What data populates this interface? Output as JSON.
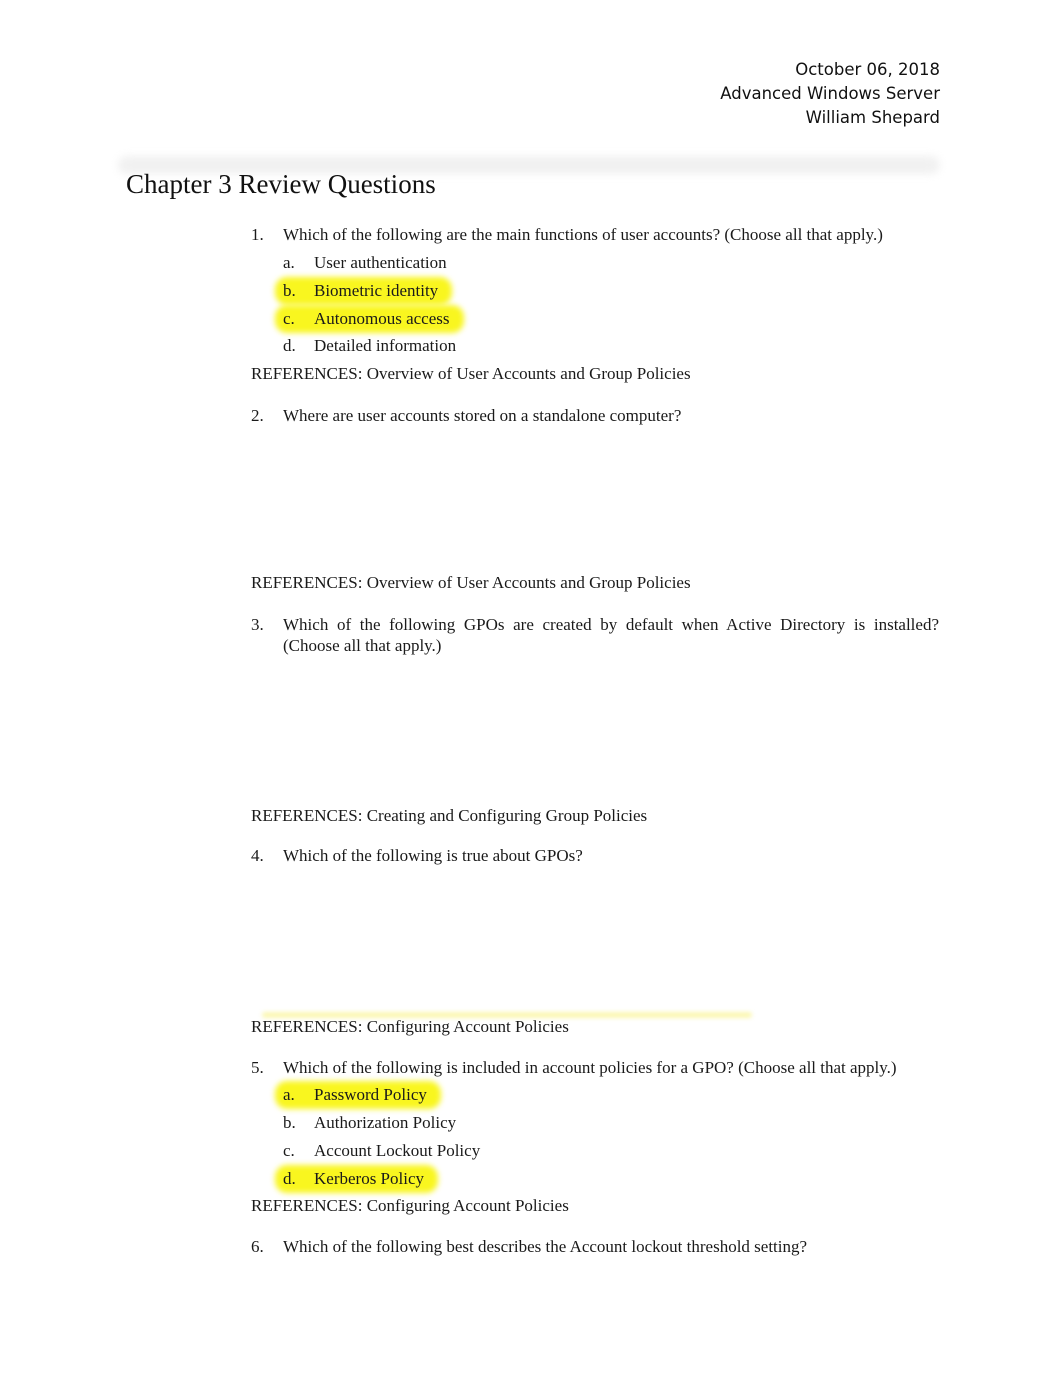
{
  "header": {
    "date": "October 06, 2018",
    "course": "Advanced Windows Server",
    "author": "William Shepard"
  },
  "title": "Chapter 3 Review Questions",
  "highlight_color": "#f9f61f",
  "questions": [
    {
      "number": "1.",
      "text": "Which of the following are the main functions of user accounts? (Choose all that apply.)",
      "options": [
        {
          "letter": "a.",
          "text": "User authentication",
          "highlighted": false
        },
        {
          "letter": "b.",
          "text": "Biometric identity",
          "highlighted": true
        },
        {
          "letter": "c.",
          "text": "Autonomous access",
          "highlighted": true
        },
        {
          "letter": "d.",
          "text": "Detailed information",
          "highlighted": false
        }
      ],
      "reference": "REFERENCES: Overview of User Accounts and Group Policies"
    },
    {
      "number": "2.",
      "text": "Where are user accounts stored on a standalone computer?",
      "options": [],
      "reference": "REFERENCES: Overview of User Accounts and Group Policies"
    },
    {
      "number": "3.",
      "text": "Which of the following GPOs are created by default when Active Directory is installed? (Choose all that apply.)",
      "options": [],
      "reference": "REFERENCES: Creating and Configuring Group Policies"
    },
    {
      "number": "4.",
      "text": "Which of the following is true about GPOs?",
      "options": [],
      "reference": "REFERENCES: Configuring Account Policies"
    },
    {
      "number": "5.",
      "text": "Which of the following is included in account policies for a GPO? (Choose all that apply.)",
      "options": [
        {
          "letter": "a.",
          "text": "Password Policy",
          "highlighted": true
        },
        {
          "letter": "b.",
          "text": "Authorization Policy",
          "highlighted": false
        },
        {
          "letter": "c.",
          "text": "Account Lockout Policy",
          "highlighted": false
        },
        {
          "letter": "d.",
          "text": "Kerberos Policy",
          "highlighted": true
        }
      ],
      "reference": "REFERENCES: Configuring Account Policies"
    },
    {
      "number": "6.",
      "text": "Which of the following best describes the Account lockout threshold setting?",
      "options": []
    }
  ]
}
